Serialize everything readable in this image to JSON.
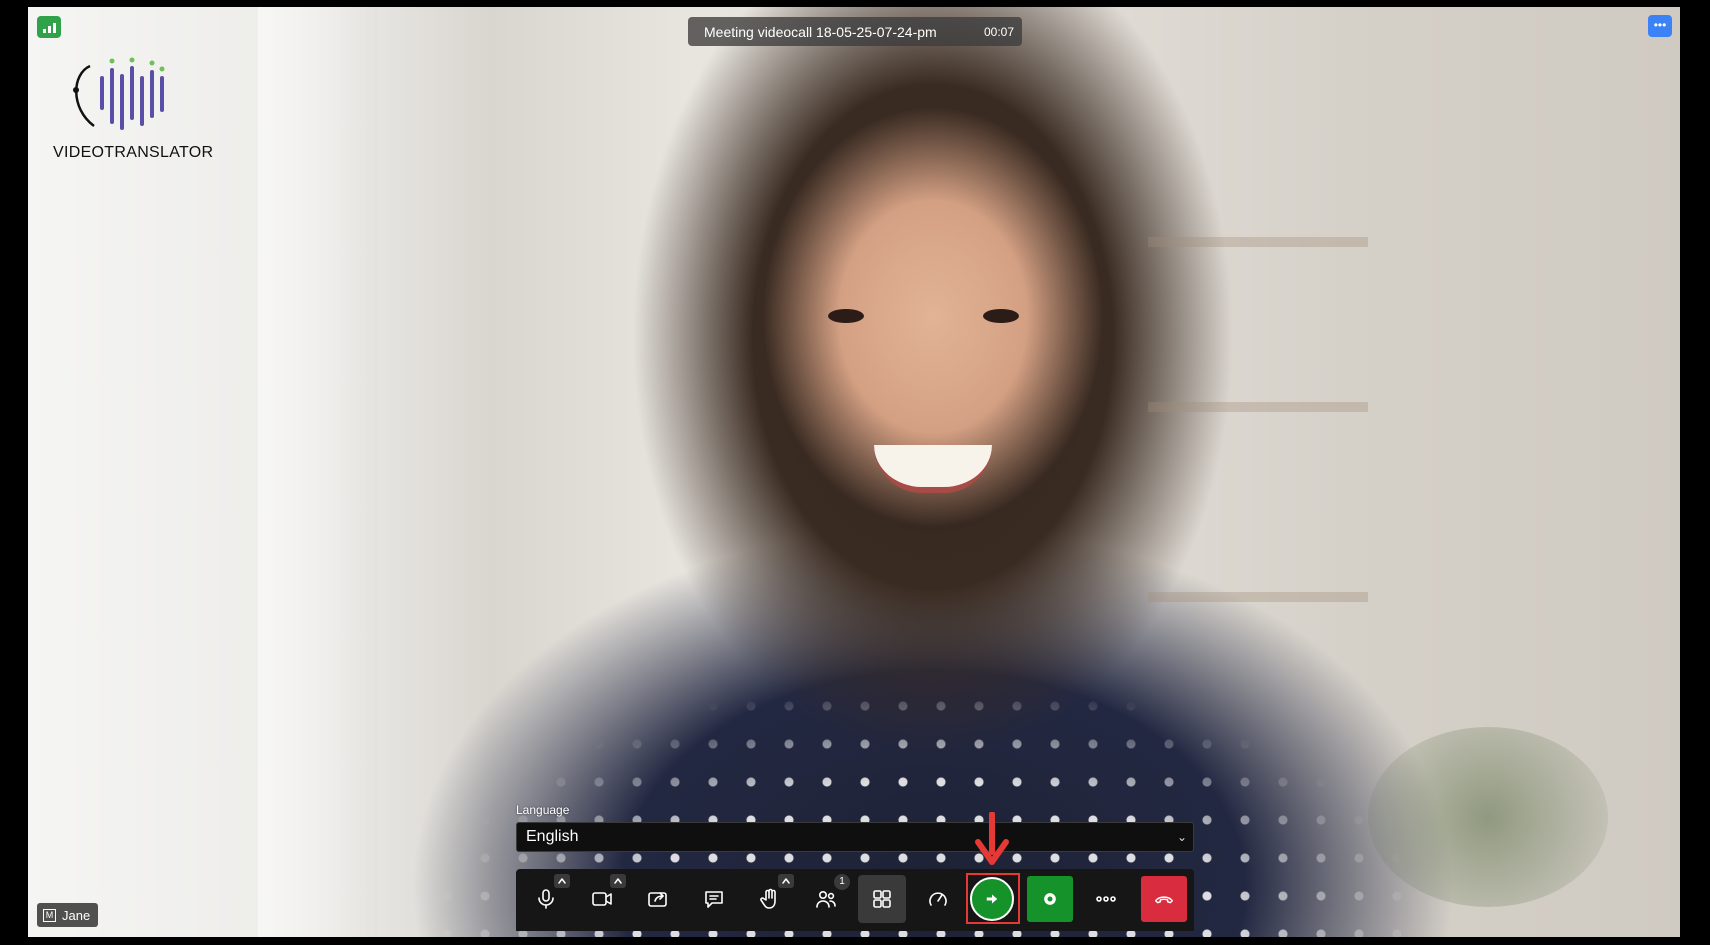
{
  "meeting": {
    "title": "Meeting videocall 18-05-25-07-24-pm",
    "elapsed": "00:07"
  },
  "brand": {
    "name": "VIDEOTRANSLATOR",
    "logo_colors": [
      "#111111",
      "#5a4fa8",
      "#6fbf5a"
    ]
  },
  "language": {
    "label": "Language",
    "selected": "English"
  },
  "participant": {
    "name": "Jane",
    "tag_icon": "M"
  },
  "toolbar": {
    "participants_count": "1",
    "items": [
      {
        "icon": "microphone-icon",
        "has_menu": true
      },
      {
        "icon": "camera-icon",
        "has_menu": true
      },
      {
        "icon": "share-screen-icon"
      },
      {
        "icon": "chat-icon"
      },
      {
        "icon": "raise-hand-icon",
        "has_menu": true
      },
      {
        "icon": "participants-icon",
        "badge": "1"
      },
      {
        "icon": "tile-view-icon",
        "active": true
      },
      {
        "icon": "performance-gauge-icon"
      },
      {
        "icon": "translate-start-icon",
        "highlighted": true
      },
      {
        "icon": "record-icon"
      },
      {
        "icon": "more-options-icon"
      },
      {
        "icon": "hang-up-icon"
      }
    ]
  },
  "colors": {
    "accent_green": "#16922b",
    "hangup_red": "#d92d3f",
    "highlight_red": "#e53935",
    "info_blue": "#3b82f6"
  }
}
